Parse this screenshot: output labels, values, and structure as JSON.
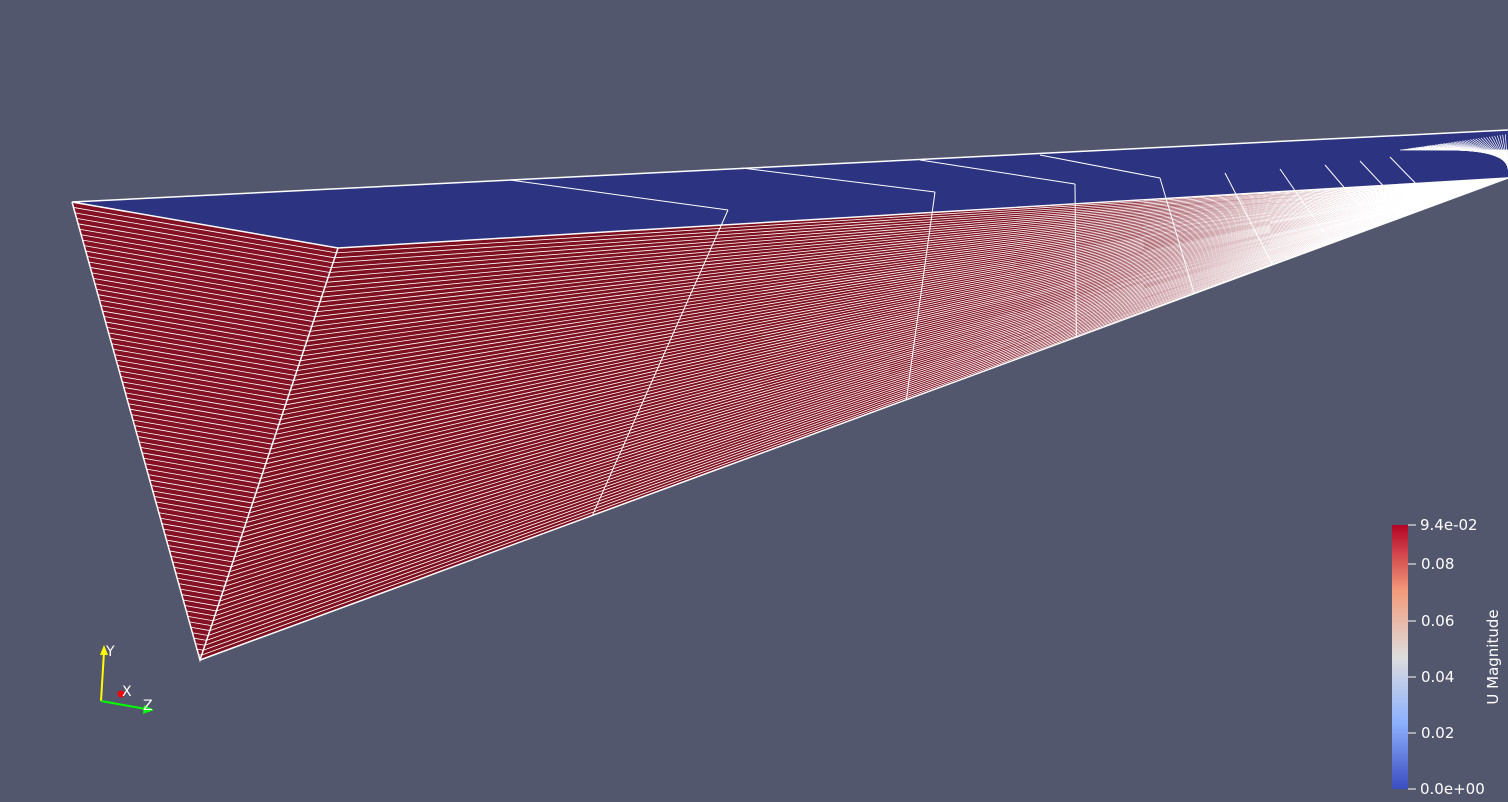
{
  "background_color": "#52576e",
  "mesh": {
    "top_face_color": "#2c3381",
    "side_face_color": "#7e0f1f",
    "end_face_color": "#841123",
    "edge_color": "#ffffff"
  },
  "colorbar": {
    "title": "U Magnitude",
    "max_label": "9.4e-02",
    "min_label": "0.0e+00",
    "ticks": [
      "0.08",
      "0.06",
      "0.04",
      "0.02"
    ],
    "colormap": [
      "#3b4cc0",
      "#8db0fe",
      "#dddddd",
      "#f49a7b",
      "#b40426"
    ]
  },
  "orientation_axes": {
    "x_label": "X",
    "y_label": "Y",
    "z_label": "Z",
    "x_color": "#ff0000",
    "y_color": "#ffff00",
    "z_color": "#00ff00"
  }
}
